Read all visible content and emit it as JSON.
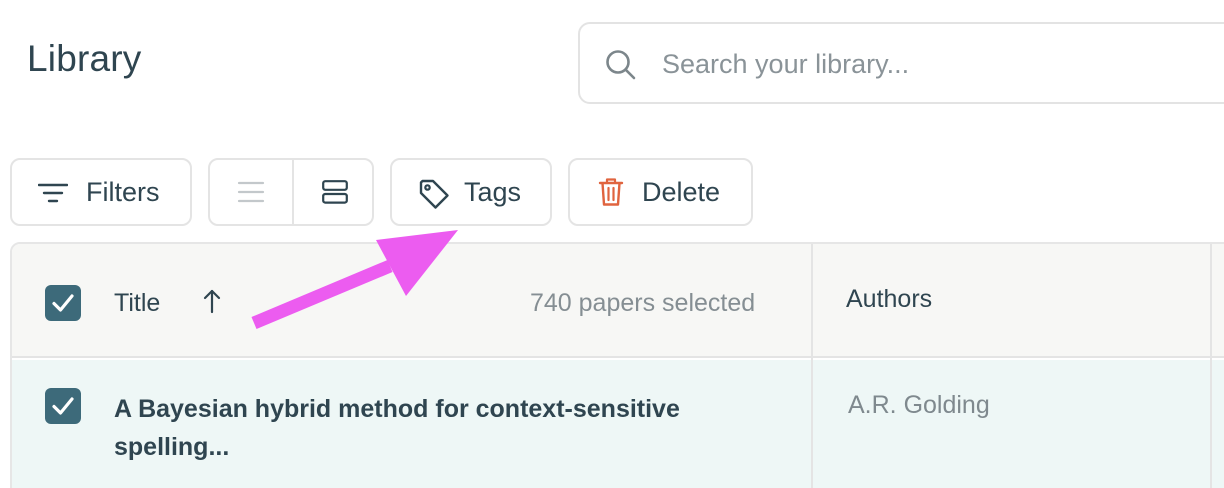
{
  "header": {
    "title": "Library",
    "search_placeholder": "Search your library..."
  },
  "toolbar": {
    "filters_label": "Filters",
    "tags_label": "Tags",
    "delete_label": "Delete",
    "view_modes": [
      "list-view-icon",
      "card-view-icon"
    ],
    "active_view": "card"
  },
  "table": {
    "columns": {
      "title": "Title",
      "authors": "Authors"
    },
    "sort_icon": "arrow-up-icon",
    "selected_count": "740 papers selected",
    "rows": [
      {
        "title": "A Bayesian hybrid method for context-sensitive spelling...",
        "authors": "A.R. Golding",
        "checked": true
      }
    ]
  },
  "colors": {
    "checkbox": "#3d6a7a",
    "delete_icon": "#e0643f",
    "annotation_arrow": "#ec5cf0",
    "row_highlight": "#eef7f6"
  }
}
